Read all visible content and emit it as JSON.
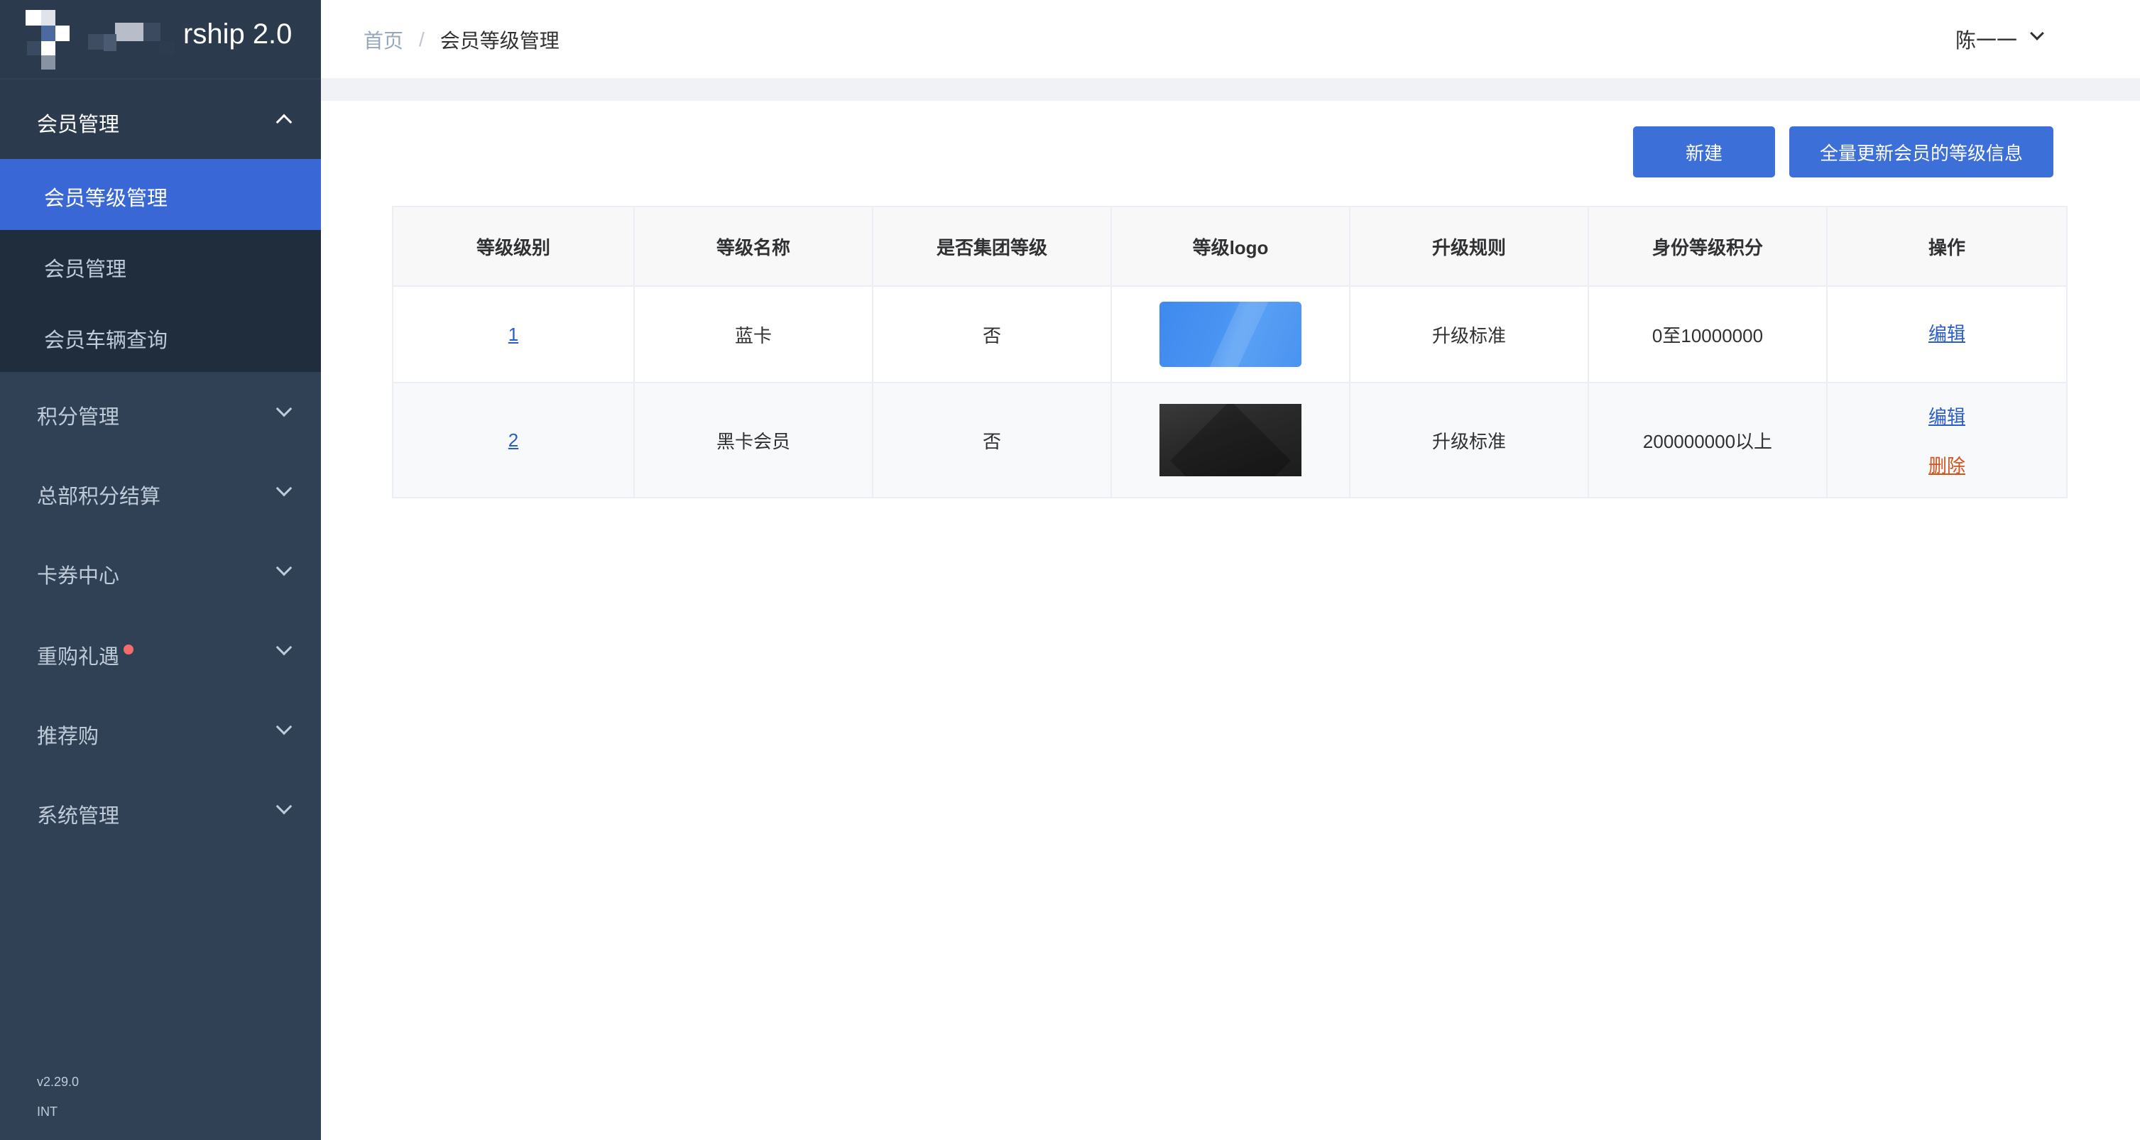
{
  "app": {
    "logo_text": "rship 2.0"
  },
  "sidebar": {
    "groups": [
      {
        "label": "会员管理",
        "expanded": true
      },
      {
        "label": "积分管理"
      },
      {
        "label": "总部积分结算"
      },
      {
        "label": "卡券中心"
      },
      {
        "label": "重购礼遇",
        "badge_dot": true
      },
      {
        "label": "推荐购"
      },
      {
        "label": "系统管理"
      }
    ],
    "sub_items": [
      {
        "label": "会员等级管理",
        "active": true
      },
      {
        "label": "会员管理"
      },
      {
        "label": "会员车辆查询"
      }
    ],
    "version": "v2.29.0",
    "env": "INT"
  },
  "breadcrumb": {
    "home": "首页",
    "separator": "/",
    "current": "会员等级管理"
  },
  "user": {
    "name": "陈一一"
  },
  "toolbar": {
    "new_label": "新建",
    "update_all_label": "全量更新会员的等级信息"
  },
  "table": {
    "headers": [
      "等级级别",
      "等级名称",
      "是否集团等级",
      "等级logo",
      "升级规则",
      "身份等级积分",
      "操作"
    ],
    "rows": [
      {
        "level": "1",
        "name": "蓝卡",
        "group_level": "否",
        "logo": "blue-card",
        "rule": "升级标准",
        "points": "0至10000000",
        "actions": [
          "编辑"
        ]
      },
      {
        "level": "2",
        "name": "黑卡会员",
        "group_level": "否",
        "logo": "black-card",
        "rule": "升级标准",
        "points": "200000000以上",
        "actions": [
          "编辑",
          "删除"
        ]
      }
    ]
  },
  "colors": {
    "sidebar_bg": "#304156",
    "active_item": "#3968d6",
    "primary_button": "#3d6fd8",
    "delete_link": "#d2541c",
    "edit_link": "#2a5dc9"
  }
}
